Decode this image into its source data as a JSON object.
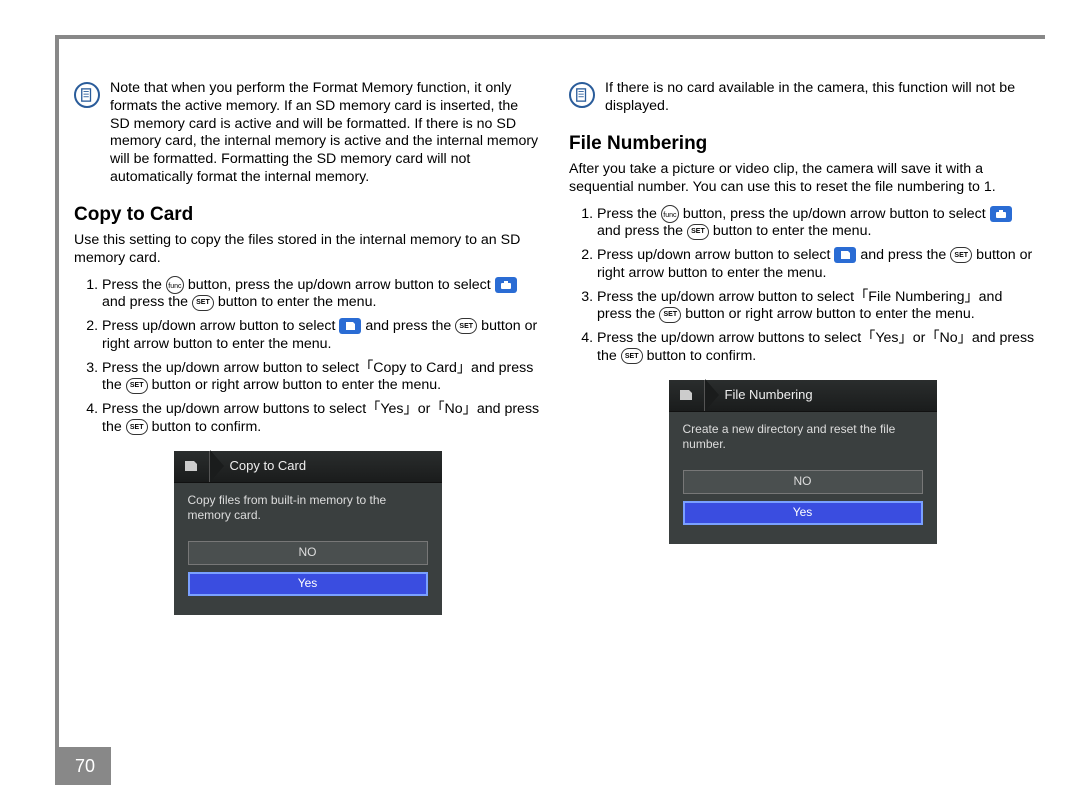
{
  "page_number": "70",
  "left": {
    "note": "Note that when you perform the Format Memory function, it only formats the active memory. If an SD memory card is inserted, the SD memory card is active and will be formatted. If there is no SD memory card, the internal memory is active and the internal memory will be formatted. Formatting the SD memory card will not automatically format the internal memory.",
    "heading": "Copy to Card",
    "intro": "Use this setting to copy the files stored in the internal memory to an SD memory card.",
    "steps": {
      "s1a": "Press the ",
      "s1b": " button, press the up/down arrow button to select ",
      "s1c": " and press the ",
      "s1d": " button to enter the menu.",
      "s2a": "Press up/down arrow button to select ",
      "s2b": " and press the ",
      "s2c": " button or right arrow button to enter the menu.",
      "s3a": "Press the up/down arrow button to select「Copy to Card」and press the ",
      "s3b": " button or right arrow button to enter the menu.",
      "s4a": "Press the up/down arrow buttons to select「Yes」or「No」and press the ",
      "s4b": " button to confirm."
    },
    "screenshot": {
      "title": "Copy to Card",
      "body": "Copy files from built-in memory to the memory card.",
      "btn_no": "NO",
      "btn_yes": "Yes"
    }
  },
  "right": {
    "note": "If there is no card available in the camera, this function will not be displayed.",
    "heading": "File Numbering",
    "intro": "After you take a picture or video clip, the camera will save it with a sequential number. You can use this to reset the file numbering to 1.",
    "steps": {
      "s1a": "Press the ",
      "s1b": " button, press the up/down arrow button to select ",
      "s1c": " and press the ",
      "s1d": " button to enter the menu.",
      "s2a": "Press up/down arrow button to select ",
      "s2b": " and press the ",
      "s2c": " button or right arrow button to enter the menu.",
      "s3a": "Press the up/down arrow button to select「File Numbering」and press the ",
      "s3b": " button or right arrow button to enter the menu.",
      "s4a": "Press the up/down arrow buttons to select「Yes」or「No」and press the ",
      "s4b": " button to confirm."
    },
    "screenshot": {
      "title": "File Numbering",
      "body": "Create a new directory and reset the file number.",
      "btn_no": "NO",
      "btn_yes": "Yes"
    }
  },
  "icons": {
    "func": "func",
    "set": "SET"
  }
}
